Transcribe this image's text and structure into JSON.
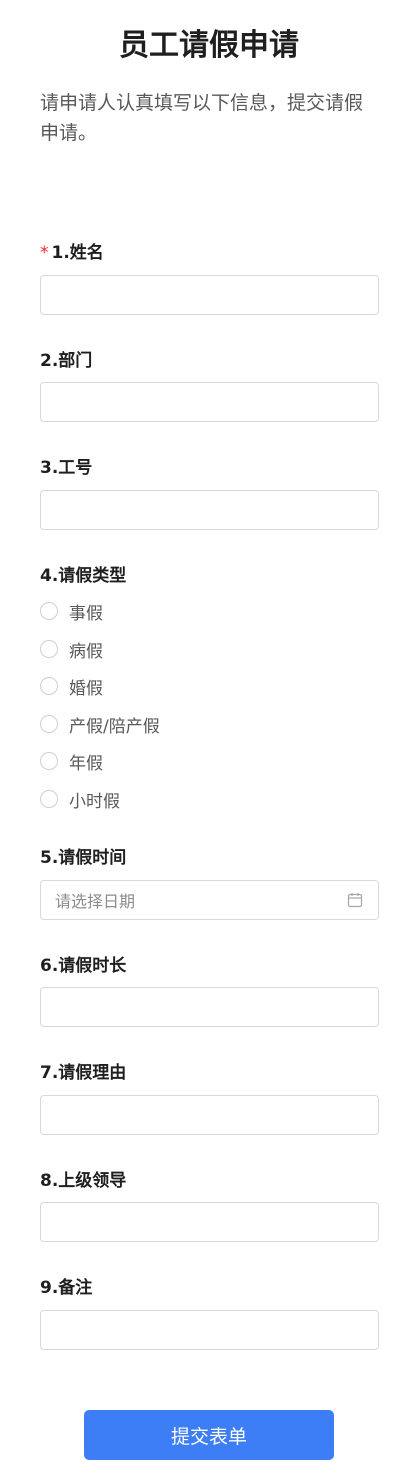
{
  "form": {
    "title": "员工请假申请",
    "description": "请申请人认真填写以下信息，提交请假申请。",
    "required_mark": "*"
  },
  "fields": {
    "name": {
      "label": "1.姓名",
      "value": ""
    },
    "department": {
      "label": "2.部门",
      "value": ""
    },
    "employee_id": {
      "label": "3.工号",
      "value": ""
    },
    "leave_type": {
      "label": "4.请假类型",
      "options": [
        "事假",
        "病假",
        "婚假",
        "产假/陪产假",
        "年假",
        "小时假"
      ]
    },
    "leave_time": {
      "label": "5.请假时间",
      "placeholder": "请选择日期",
      "icon": "calendar-icon"
    },
    "duration": {
      "label": "6.请假时长",
      "value": ""
    },
    "reason": {
      "label": "7.请假理由",
      "value": ""
    },
    "supervisor": {
      "label": "8.上级领导",
      "value": ""
    },
    "remarks": {
      "label": "9.备注",
      "value": ""
    }
  },
  "submit": {
    "label": "提交表单",
    "color": "#3d7ef6"
  }
}
